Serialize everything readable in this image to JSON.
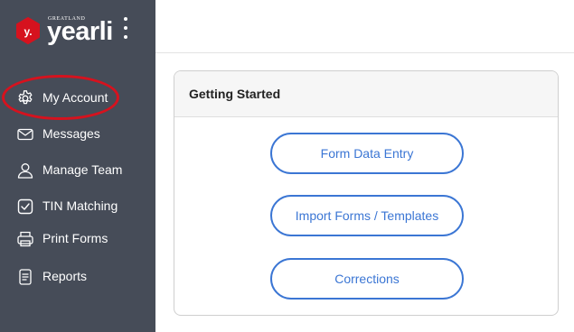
{
  "brand": {
    "small_text": "GREATLAND",
    "name": "yearli",
    "mark_letter": "y.",
    "color": "#d6121e"
  },
  "sidebar": {
    "background": "#464c58",
    "items": [
      {
        "label": "My Account",
        "icon": "gear-icon"
      },
      {
        "label": "Messages",
        "icon": "envelope-icon"
      },
      {
        "label": "Manage Team",
        "icon": "user-icon"
      },
      {
        "label": "TIN Matching",
        "icon": "checkbox-icon"
      },
      {
        "label": "Print Forms",
        "icon": "printer-icon"
      },
      {
        "label": "Reports",
        "icon": "report-icon"
      }
    ]
  },
  "card": {
    "title": "Getting Started",
    "buttons": [
      {
        "label": "Form Data Entry"
      },
      {
        "label": "Import Forms / Templates"
      },
      {
        "label": "Corrections"
      }
    ],
    "accent": "#3b76d4"
  }
}
